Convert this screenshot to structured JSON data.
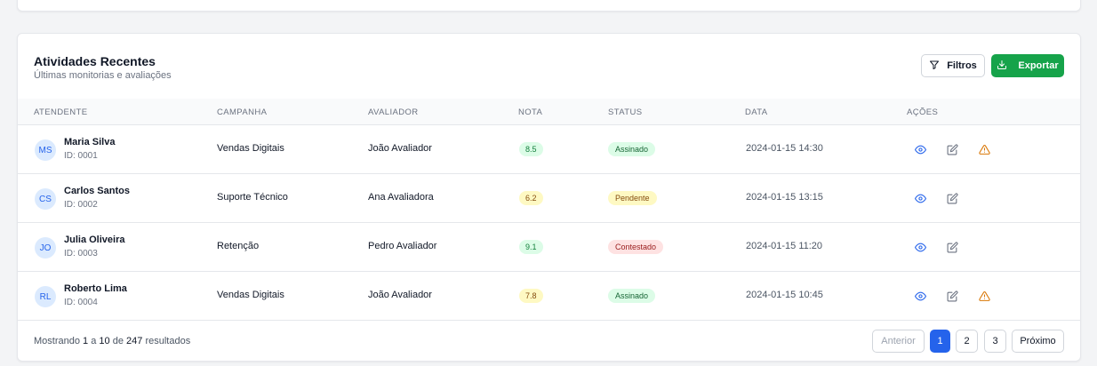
{
  "card": {
    "title": "Atividades Recentes",
    "subtitle": "Últimas monitorias e avaliações",
    "filters_label": "Filtros",
    "export_label": "Exportar"
  },
  "table": {
    "headers": [
      "ATENDENTE",
      "CAMPANHA",
      "AVALIADOR",
      "NOTA",
      "STATUS",
      "DATA",
      "AÇÕES"
    ],
    "rows": [
      {
        "initials": "MS",
        "name": "Maria Silva",
        "id": "ID: 0001",
        "campaign": "Vendas Digitais",
        "evaluator": "João Avaliador",
        "score": "8.5",
        "score_color": "green",
        "status": "Assinado",
        "status_color": "green",
        "date": "2024-01-15 14:30",
        "has_alert": true
      },
      {
        "initials": "CS",
        "name": "Carlos Santos",
        "id": "ID: 0002",
        "campaign": "Suporte Técnico",
        "evaluator": "Ana Avaliadora",
        "score": "6.2",
        "score_color": "yellow",
        "status": "Pendente",
        "status_color": "yellow",
        "date": "2024-01-15 13:15",
        "has_alert": false
      },
      {
        "initials": "JO",
        "name": "Julia Oliveira",
        "id": "ID: 0003",
        "campaign": "Retenção",
        "evaluator": "Pedro Avaliador",
        "score": "9.1",
        "score_color": "green",
        "status": "Contestado",
        "status_color": "red",
        "date": "2024-01-15 11:20",
        "has_alert": false
      },
      {
        "initials": "RL",
        "name": "Roberto Lima",
        "id": "ID: 0004",
        "campaign": "Vendas Digitais",
        "evaluator": "João Avaliador",
        "score": "7.8",
        "score_color": "yellow",
        "status": "Assinado",
        "status_color": "green",
        "date": "2024-01-15 10:45",
        "has_alert": true
      }
    ],
    "action_icons": [
      "eye-icon",
      "edit-icon",
      "alert-triangle-icon"
    ]
  },
  "footer": {
    "showing_prefix": "Mostrando",
    "range_start": "1",
    "range_sep": "a",
    "range_end": "10",
    "of_label": "de",
    "total": "247",
    "results_label": "resultados",
    "prev_label": "Anterior",
    "pages": [
      "1",
      "2",
      "3"
    ],
    "current_page": "1",
    "next_label": "Próximo"
  },
  "colors": {
    "accent": "#2563eb",
    "export_green": "#16a34a",
    "alert_orange": "#d97706"
  }
}
